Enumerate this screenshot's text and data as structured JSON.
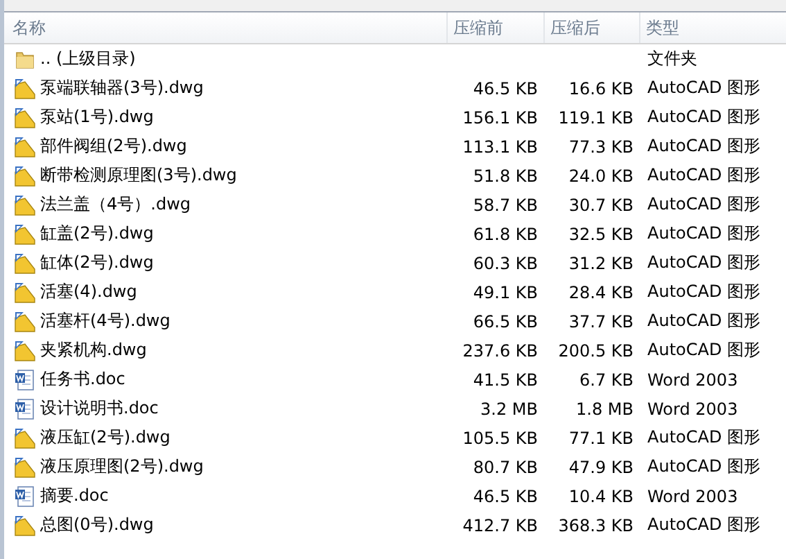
{
  "columns": [
    "名称",
    "压缩前",
    "压缩后",
    "类型"
  ],
  "rows": [
    {
      "kind": "folder",
      "name": ".. (上级目录)",
      "before": "",
      "after": "",
      "type": "文件夹"
    },
    {
      "kind": "dwg",
      "name": "泵端联轴器(3号).dwg",
      "before": "46.5 KB",
      "after": "16.6 KB",
      "type": "AutoCAD 图形"
    },
    {
      "kind": "dwg",
      "name": "泵站(1号).dwg",
      "before": "156.1 KB",
      "after": "119.1 KB",
      "type": "AutoCAD 图形"
    },
    {
      "kind": "dwg",
      "name": "部件阀组(2号).dwg",
      "before": "113.1 KB",
      "after": "77.3 KB",
      "type": "AutoCAD 图形"
    },
    {
      "kind": "dwg",
      "name": "断带检测原理图(3号).dwg",
      "before": "51.8 KB",
      "after": "24.0 KB",
      "type": "AutoCAD 图形"
    },
    {
      "kind": "dwg",
      "name": "法兰盖（4号）.dwg",
      "before": "58.7 KB",
      "after": "30.7 KB",
      "type": "AutoCAD 图形"
    },
    {
      "kind": "dwg",
      "name": "缸盖(2号).dwg",
      "before": "61.8 KB",
      "after": "32.5 KB",
      "type": "AutoCAD 图形"
    },
    {
      "kind": "dwg",
      "name": "缸体(2号).dwg",
      "before": "60.3 KB",
      "after": "31.2 KB",
      "type": "AutoCAD 图形"
    },
    {
      "kind": "dwg",
      "name": "活塞(4).dwg",
      "before": "49.1 KB",
      "after": "28.4 KB",
      "type": "AutoCAD 图形"
    },
    {
      "kind": "dwg",
      "name": "活塞杆(4号).dwg",
      "before": "66.5 KB",
      "after": "37.7 KB",
      "type": "AutoCAD 图形"
    },
    {
      "kind": "dwg",
      "name": "夹紧机构.dwg",
      "before": "237.6 KB",
      "after": "200.5 KB",
      "type": "AutoCAD 图形"
    },
    {
      "kind": "doc",
      "name": "任务书.doc",
      "before": "41.5 KB",
      "after": "6.7 KB",
      "type": "Word 2003"
    },
    {
      "kind": "doc",
      "name": "设计说明书.doc",
      "before": "3.2 MB",
      "after": "1.8 MB",
      "type": "Word 2003"
    },
    {
      "kind": "dwg",
      "name": "液压缸(2号).dwg",
      "before": "105.5 KB",
      "after": "77.1 KB",
      "type": "AutoCAD 图形"
    },
    {
      "kind": "dwg",
      "name": "液压原理图(2号).dwg",
      "before": "80.7 KB",
      "after": "47.9 KB",
      "type": "AutoCAD 图形"
    },
    {
      "kind": "doc",
      "name": "摘要.doc",
      "before": "46.5 KB",
      "after": "10.4 KB",
      "type": "Word 2003"
    },
    {
      "kind": "dwg",
      "name": "总图(0号).dwg",
      "before": "412.7 KB",
      "after": "368.3 KB",
      "type": "AutoCAD 图形"
    }
  ]
}
